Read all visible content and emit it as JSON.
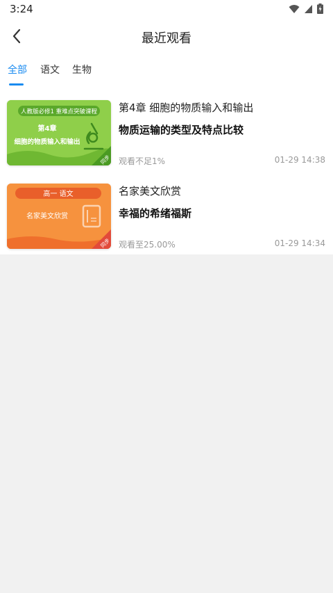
{
  "status": {
    "time": "3:24"
  },
  "header": {
    "title": "最近观看"
  },
  "tabs": [
    {
      "label": "全部",
      "active": true
    },
    {
      "label": "语文",
      "active": false
    },
    {
      "label": "生物",
      "active": false
    }
  ],
  "items": [
    {
      "thumb": {
        "banner": "人教版必修1 重难点突破课程",
        "chapter": "第4章",
        "subtitle": "细胞的物质输入和输出",
        "corner": "同步",
        "color": "#8fcf4a"
      },
      "chapter": "第4章 细胞的物质输入和输出",
      "lesson": "物质运输的类型及特点比较",
      "progress": "观看不足1%",
      "time": "01-29 14:38"
    },
    {
      "thumb": {
        "banner": "高一 语文",
        "subtitle": "名家美文欣赏",
        "corner": "同步",
        "color": "#f6923e"
      },
      "chapter": "名家美文欣赏",
      "lesson": "幸福的希绪福斯",
      "progress": "观看至25.00%",
      "time": "01-29 14:34"
    }
  ],
  "colors": {
    "accent": "#1a8bf0",
    "background": "#f1f1f1"
  }
}
